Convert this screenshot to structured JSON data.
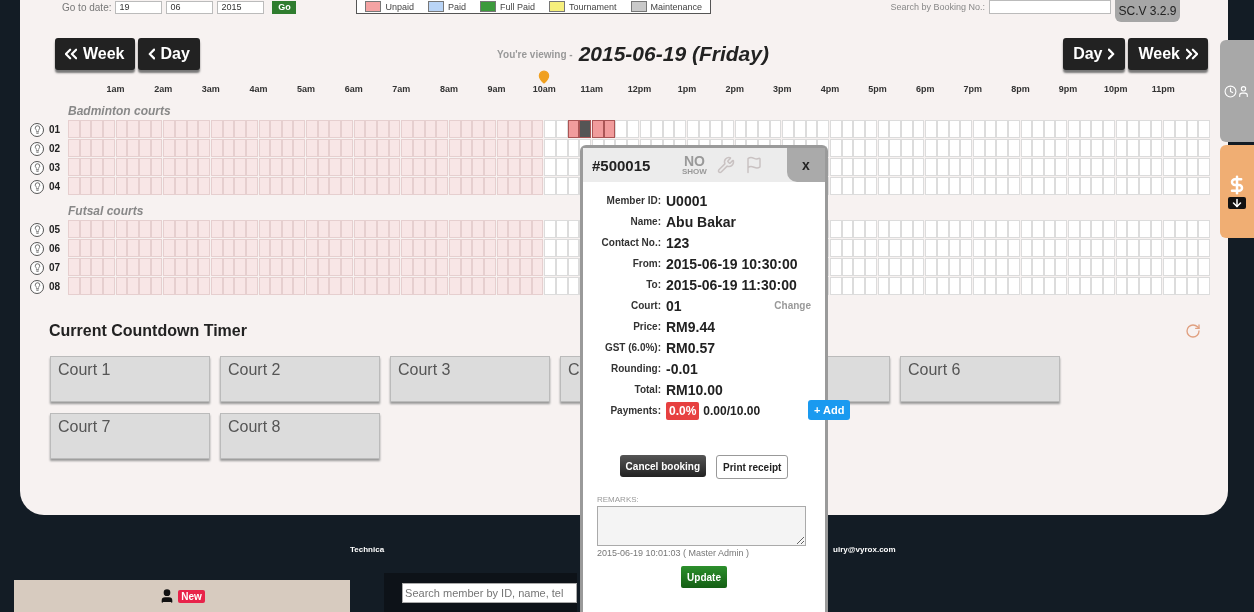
{
  "toolbar": {
    "go_to_date_label": "Go to date:",
    "date_selects": [
      "19",
      "06",
      "2015"
    ],
    "go_button": "Go",
    "search_label": "Search by Booking No.:"
  },
  "legend": [
    {
      "label": "Unpaid",
      "color": "#f4a3a3"
    },
    {
      "label": "Paid",
      "color": "#b9d4f6"
    },
    {
      "label": "Full Paid",
      "color": "#3c9a3c"
    },
    {
      "label": "Tournament",
      "color": "#f6ef7c"
    },
    {
      "label": "Maintenance",
      "color": "#c9c9c9"
    }
  ],
  "version": "SC.V 3.2.9",
  "nav": {
    "prev_week": "Week",
    "prev_day": "Day",
    "next_day": "Day",
    "next_week": "Week",
    "viewing_label": "You're viewing -",
    "date": "2015-06-19 (Friday)"
  },
  "now_marker": {
    "level": 0.4167
  },
  "hours": [
    {
      "past": true
    },
    {
      "label": "1am",
      "past": true
    },
    {
      "label": "2am",
      "past": true
    },
    {
      "label": "3am",
      "past": true
    },
    {
      "label": "4am",
      "past": true
    },
    {
      "label": "5am",
      "past": true
    },
    {
      "label": "6am",
      "past": true
    },
    {
      "label": "7am",
      "past": true
    },
    {
      "label": "8am",
      "past": true
    },
    {
      "label": "9am",
      "past": true
    },
    {
      "label": "10am",
      "past": false
    },
    {
      "label": "11am",
      "past": false
    },
    {
      "label": "12pm",
      "past": false
    },
    {
      "label": "1pm",
      "past": false
    },
    {
      "label": "2pm",
      "past": false
    },
    {
      "label": "3pm",
      "past": false
    },
    {
      "label": "4pm",
      "past": false
    },
    {
      "label": "5pm",
      "past": false
    },
    {
      "label": "6pm",
      "past": false
    },
    {
      "label": "7pm",
      "past": false
    },
    {
      "label": "8pm",
      "past": false
    },
    {
      "label": "9pm",
      "past": false
    },
    {
      "label": "10pm",
      "past": false
    },
    {
      "label": "11pm",
      "past": false
    }
  ],
  "court_groups": [
    {
      "name": "Badminton courts",
      "courts": [
        {
          "number": "01",
          "booking": {
            "level": 0.4375,
            "slots": [
              {
                "kind": "unpaid"
              },
              {
                "kind": "selected"
              },
              {
                "kind": "unpaid"
              },
              {
                "kind": "unpaid"
              }
            ]
          }
        },
        {
          "number": "02"
        },
        {
          "number": "03"
        },
        {
          "number": "04"
        }
      ]
    },
    {
      "name": "Futsal courts",
      "courts": [
        {
          "number": "05"
        },
        {
          "number": "06"
        },
        {
          "number": "07"
        },
        {
          "number": "08"
        }
      ]
    }
  ],
  "countdown": {
    "title": "Current Countdown Timer",
    "cards": [
      {
        "kind": "timer",
        "label": "Court 1"
      },
      {
        "kind": "timer",
        "label": "Court 2"
      },
      {
        "kind": "timer",
        "label": "Court 3"
      },
      {
        "kind": "timer",
        "label": "C"
      },
      {
        "kind": "covered"
      },
      {
        "kind": "timer",
        "label": "Court 6"
      },
      {
        "kind": "timer",
        "label": "Court 7"
      },
      {
        "kind": "timer",
        "label": "Court 8"
      }
    ]
  },
  "booking_popup": {
    "id": "#500015",
    "no_show": [
      "NO",
      "SHOW"
    ],
    "close": "x",
    "fields": [
      {
        "label": "Member ID:",
        "value": "U0001"
      },
      {
        "label": "Name:",
        "value": "Abu Bakar"
      },
      {
        "label": "Contact No.:",
        "value": "123"
      },
      {
        "label": "From:",
        "value": "2015-06-19 10:30:00"
      },
      {
        "label": "To:",
        "value": "2015-06-19 11:30:00"
      },
      {
        "label": "Court:",
        "value": "01",
        "action": "Change"
      },
      {
        "label": "Price:",
        "value": "RM9.44"
      },
      {
        "label": "GST (6.0%):",
        "value": "RM0.57"
      },
      {
        "label": "Rounding:",
        "value": "-0.01"
      },
      {
        "label": "Total:",
        "value": "RM10.00"
      }
    ],
    "payments": {
      "label": "Payments:",
      "percent": "0.0%",
      "amount": "0.00/10.00",
      "add_button": "+ Add"
    },
    "cancel_button": "Cancel booking",
    "print_button": "Print receipt",
    "remarks_label": "REMARKS:",
    "log": "2015-06-19 10:01:03 ( Master Admin )",
    "update_button": "Update"
  },
  "footer": {
    "new_badge": "New",
    "technical_text": "Technica",
    "member_search_placeholder": "Search member by ID, name, tel",
    "email_text": "uiry@vyrox.com"
  }
}
